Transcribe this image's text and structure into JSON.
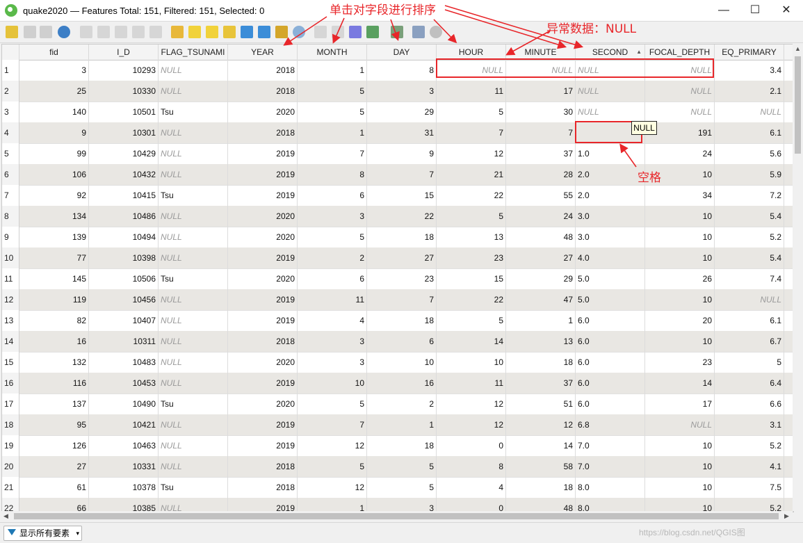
{
  "window": {
    "title": "quake2020 — Features Total: 151, Filtered: 151, Selected: 0"
  },
  "columns": [
    "fid",
    "I_D",
    "FLAG_TSUNAMI",
    "YEAR",
    "MONTH",
    "DAY",
    "HOUR",
    "MINUTE",
    "SECOND",
    "FOCAL_DEPTH",
    "EQ_PRIMARY"
  ],
  "sort": {
    "column": "SECOND",
    "direction": "ascending"
  },
  "rows": [
    {
      "n": "1",
      "fid": "3",
      "i_d": "10293",
      "flag": "NULL",
      "year": "2018",
      "month": "1",
      "day": "8",
      "hour": "NULL",
      "minute": "NULL",
      "second": "NULL",
      "depth": "NULL",
      "eq": "3.4"
    },
    {
      "n": "2",
      "fid": "25",
      "i_d": "10330",
      "flag": "NULL",
      "year": "2018",
      "month": "5",
      "day": "3",
      "hour": "11",
      "minute": "17",
      "second": "NULL",
      "depth": "NULL",
      "eq": "2.1"
    },
    {
      "n": "3",
      "fid": "140",
      "i_d": "10501",
      "flag": "Tsu",
      "year": "2020",
      "month": "5",
      "day": "29",
      "hour": "5",
      "minute": "30",
      "second": "NULL",
      "depth": "NULL",
      "eq": "NULL"
    },
    {
      "n": "4",
      "fid": "9",
      "i_d": "10301",
      "flag": "NULL",
      "year": "2018",
      "month": "1",
      "day": "31",
      "hour": "7",
      "minute": "7",
      "second": "",
      "depth": "191",
      "eq": "6.1"
    },
    {
      "n": "5",
      "fid": "99",
      "i_d": "10429",
      "flag": "NULL",
      "year": "2019",
      "month": "7",
      "day": "9",
      "hour": "12",
      "minute": "37",
      "second": "1.0",
      "depth": "24",
      "eq": "5.6"
    },
    {
      "n": "6",
      "fid": "106",
      "i_d": "10432",
      "flag": "NULL",
      "year": "2019",
      "month": "8",
      "day": "7",
      "hour": "21",
      "minute": "28",
      "second": "2.0",
      "depth": "10",
      "eq": "5.9"
    },
    {
      "n": "7",
      "fid": "92",
      "i_d": "10415",
      "flag": "Tsu",
      "year": "2019",
      "month": "6",
      "day": "15",
      "hour": "22",
      "minute": "55",
      "second": "2.0",
      "depth": "34",
      "eq": "7.2"
    },
    {
      "n": "8",
      "fid": "134",
      "i_d": "10486",
      "flag": "NULL",
      "year": "2020",
      "month": "3",
      "day": "22",
      "hour": "5",
      "minute": "24",
      "second": "3.0",
      "depth": "10",
      "eq": "5.4"
    },
    {
      "n": "9",
      "fid": "139",
      "i_d": "10494",
      "flag": "NULL",
      "year": "2020",
      "month": "5",
      "day": "18",
      "hour": "13",
      "minute": "48",
      "second": "3.0",
      "depth": "10",
      "eq": "5.2"
    },
    {
      "n": "10",
      "fid": "77",
      "i_d": "10398",
      "flag": "NULL",
      "year": "2019",
      "month": "2",
      "day": "27",
      "hour": "23",
      "minute": "27",
      "second": "4.0",
      "depth": "10",
      "eq": "5.4"
    },
    {
      "n": "11",
      "fid": "145",
      "i_d": "10506",
      "flag": "Tsu",
      "year": "2020",
      "month": "6",
      "day": "23",
      "hour": "15",
      "minute": "29",
      "second": "5.0",
      "depth": "26",
      "eq": "7.4"
    },
    {
      "n": "12",
      "fid": "119",
      "i_d": "10456",
      "flag": "NULL",
      "year": "2019",
      "month": "11",
      "day": "7",
      "hour": "22",
      "minute": "47",
      "second": "5.0",
      "depth": "10",
      "eq": "NULL"
    },
    {
      "n": "13",
      "fid": "82",
      "i_d": "10407",
      "flag": "NULL",
      "year": "2019",
      "month": "4",
      "day": "18",
      "hour": "5",
      "minute": "1",
      "second": "6.0",
      "depth": "20",
      "eq": "6.1"
    },
    {
      "n": "14",
      "fid": "16",
      "i_d": "10311",
      "flag": "NULL",
      "year": "2018",
      "month": "3",
      "day": "6",
      "hour": "14",
      "minute": "13",
      "second": "6.0",
      "depth": "10",
      "eq": "6.7"
    },
    {
      "n": "15",
      "fid": "132",
      "i_d": "10483",
      "flag": "NULL",
      "year": "2020",
      "month": "3",
      "day": "10",
      "hour": "10",
      "minute": "18",
      "second": "6.0",
      "depth": "23",
      "eq": "5"
    },
    {
      "n": "16",
      "fid": "116",
      "i_d": "10453",
      "flag": "NULL",
      "year": "2019",
      "month": "10",
      "day": "16",
      "hour": "11",
      "minute": "37",
      "second": "6.0",
      "depth": "14",
      "eq": "6.4"
    },
    {
      "n": "17",
      "fid": "137",
      "i_d": "10490",
      "flag": "Tsu",
      "year": "2020",
      "month": "5",
      "day": "2",
      "hour": "12",
      "minute": "51",
      "second": "6.0",
      "depth": "17",
      "eq": "6.6"
    },
    {
      "n": "18",
      "fid": "95",
      "i_d": "10421",
      "flag": "NULL",
      "year": "2019",
      "month": "7",
      "day": "1",
      "hour": "12",
      "minute": "12",
      "second": "6.8",
      "depth": "NULL",
      "eq": "3.1"
    },
    {
      "n": "19",
      "fid": "126",
      "i_d": "10463",
      "flag": "NULL",
      "year": "2019",
      "month": "12",
      "day": "18",
      "hour": "0",
      "minute": "14",
      "second": "7.0",
      "depth": "10",
      "eq": "5.2"
    },
    {
      "n": "20",
      "fid": "27",
      "i_d": "10331",
      "flag": "NULL",
      "year": "2018",
      "month": "5",
      "day": "5",
      "hour": "8",
      "minute": "58",
      "second": "7.0",
      "depth": "10",
      "eq": "4.1"
    },
    {
      "n": "21",
      "fid": "61",
      "i_d": "10378",
      "flag": "Tsu",
      "year": "2018",
      "month": "12",
      "day": "5",
      "hour": "4",
      "minute": "18",
      "second": "8.0",
      "depth": "10",
      "eq": "7.5"
    },
    {
      "n": "22",
      "fid": "66",
      "i_d": "10385",
      "flag": "NULL",
      "year": "2019",
      "month": "1",
      "day": "3",
      "hour": "0",
      "minute": "48",
      "second": "8.0",
      "depth": "10",
      "eq": "5.2"
    }
  ],
  "tooltip": "NULL",
  "annotations": {
    "sort_hint": "单击对字段进行排序",
    "abnormal": "异常数据：NULL",
    "space": "空格"
  },
  "status": {
    "filter_button": "显示所有要素"
  },
  "watermark": "https://blog.csdn.net/QGIS图"
}
